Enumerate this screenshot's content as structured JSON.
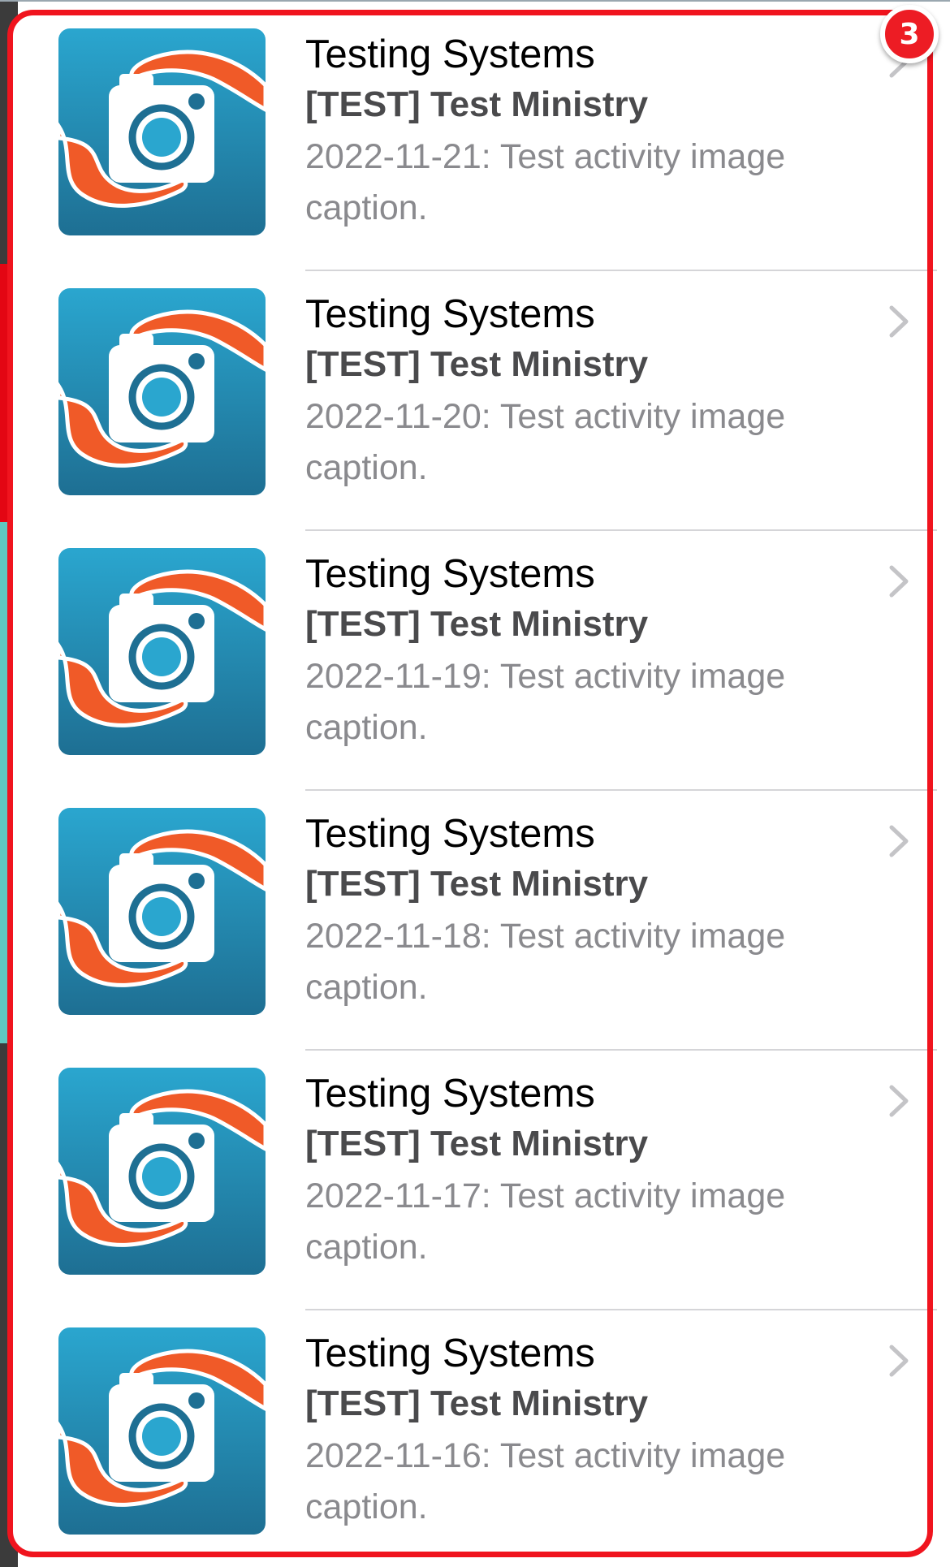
{
  "badge": {
    "label": "3"
  },
  "colors": {
    "highlight": "#f0141e",
    "thumb_top": "#2aa6cf",
    "thumb_bottom": "#1e6f93",
    "tentacle": "#f05a28"
  },
  "icons": {
    "thumbnail": "camera-tentacle-logo",
    "chevron": "chevron-right-icon"
  },
  "items": [
    {
      "title": "Testing Systems",
      "subtitle": "[TEST] Test Ministry",
      "caption": "2022-11-21: Test activity image caption."
    },
    {
      "title": "Testing Systems",
      "subtitle": "[TEST] Test Ministry",
      "caption": "2022-11-20: Test activity image caption."
    },
    {
      "title": "Testing Systems",
      "subtitle": "[TEST] Test Ministry",
      "caption": "2022-11-19: Test activity image caption."
    },
    {
      "title": "Testing Systems",
      "subtitle": "[TEST] Test Ministry",
      "caption": "2022-11-18: Test activity image caption."
    },
    {
      "title": "Testing Systems",
      "subtitle": "[TEST] Test Ministry",
      "caption": "2022-11-17: Test activity image caption."
    },
    {
      "title": "Testing Systems",
      "subtitle": "[TEST] Test Ministry",
      "caption": "2022-11-16: Test activity image caption."
    }
  ]
}
